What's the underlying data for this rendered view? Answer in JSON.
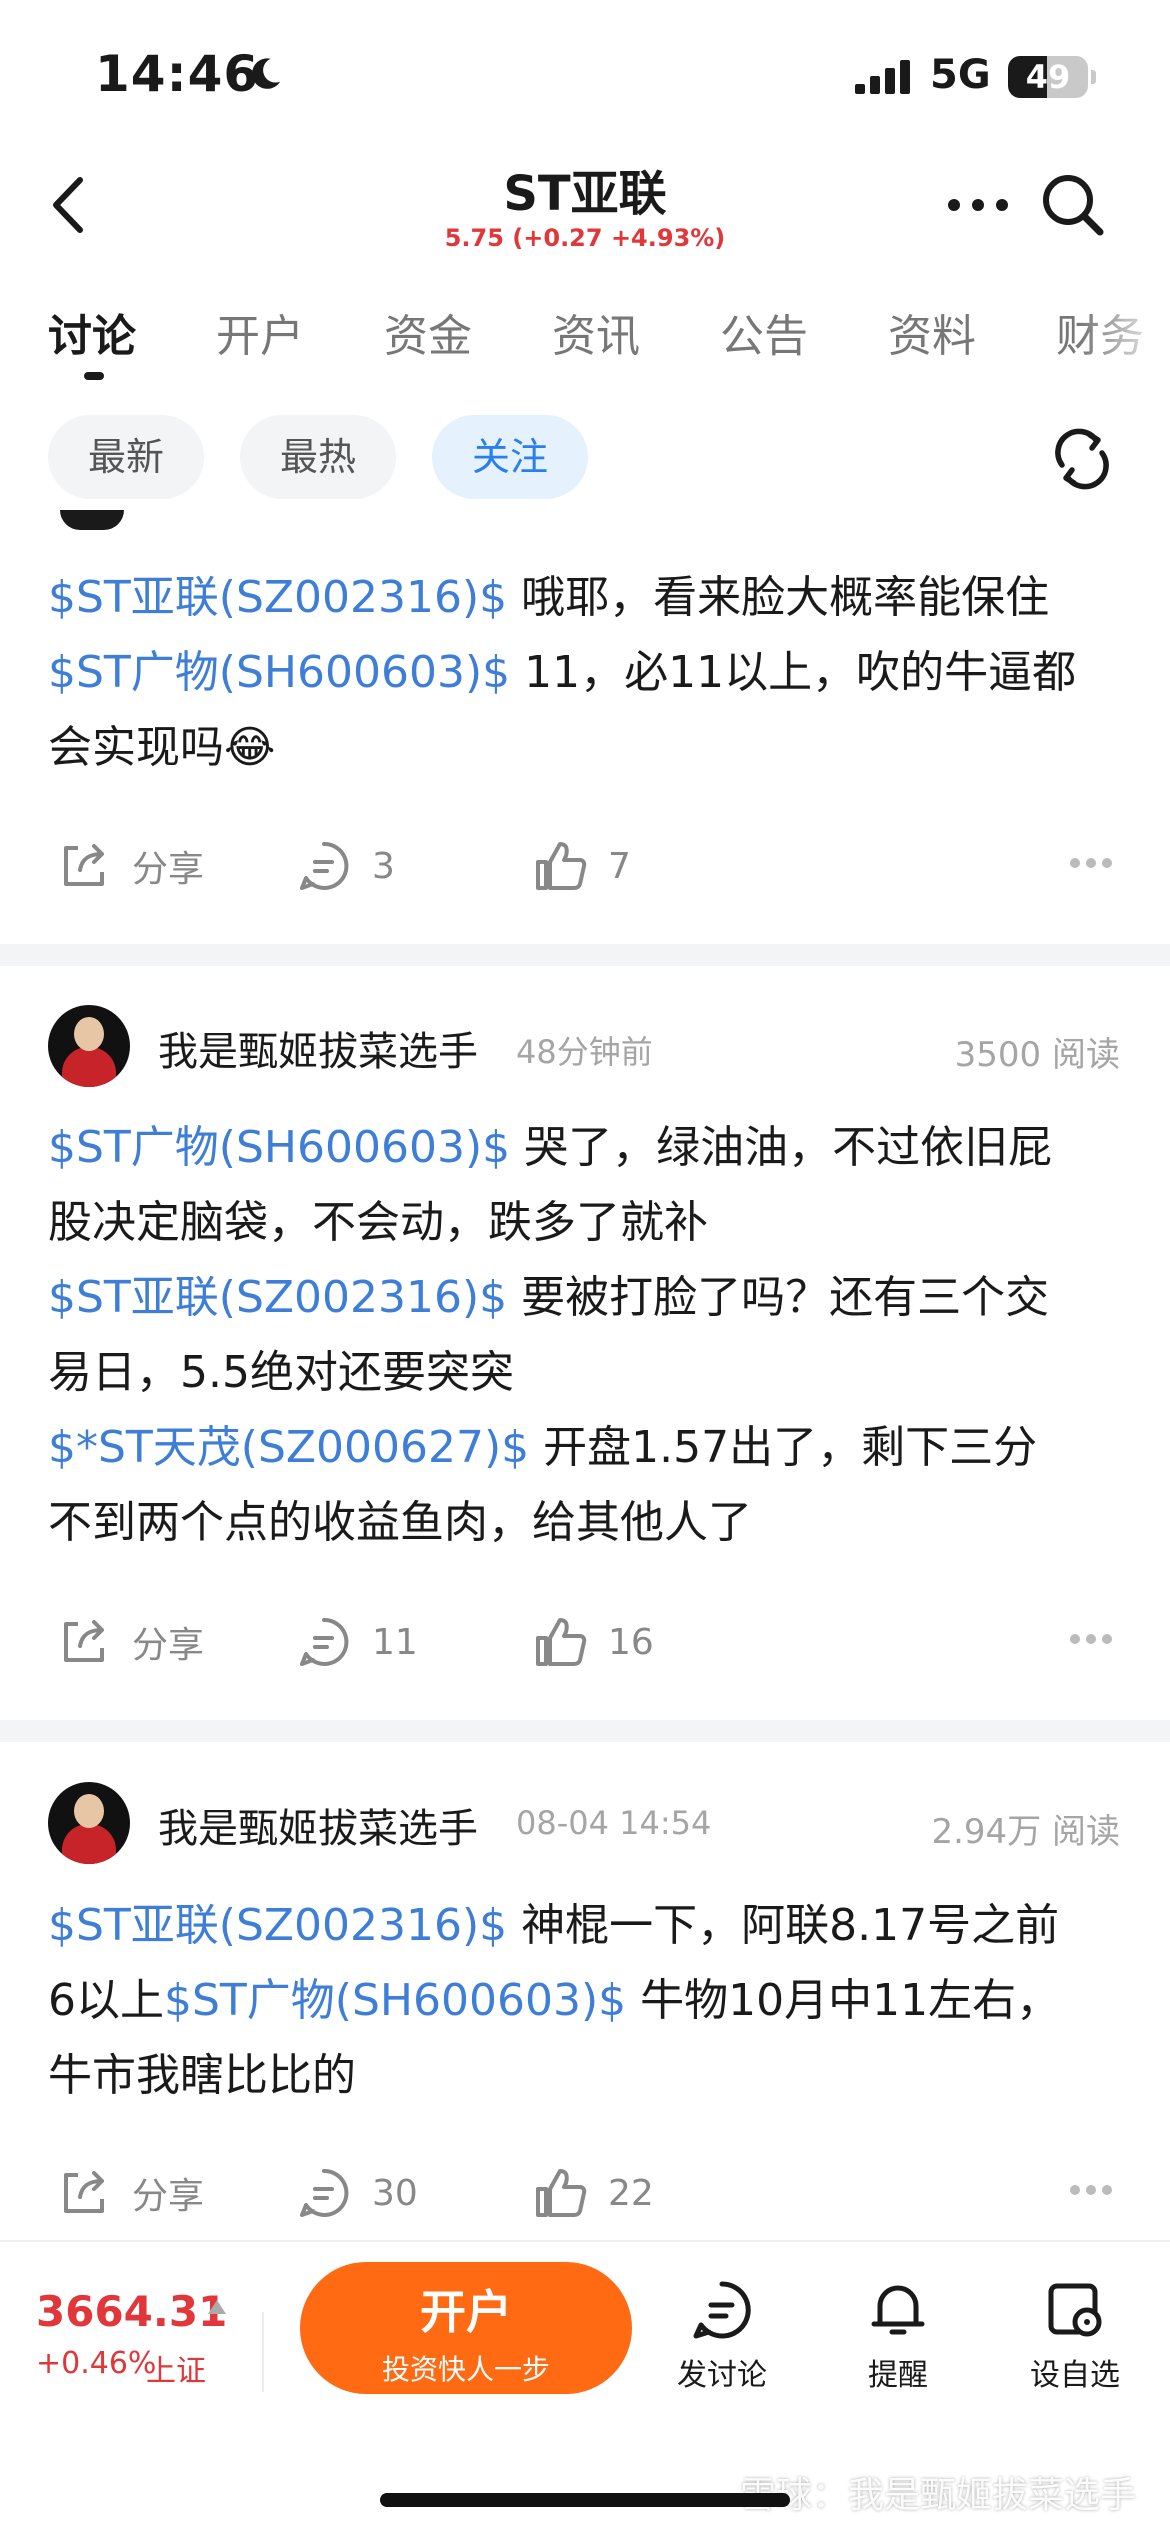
{
  "status_bar": {
    "time": "14:46",
    "network": "5G",
    "battery": "49",
    "battery_level": 0.49
  },
  "header": {
    "title": "ST亚联",
    "price_line": "5.75 (+0.27 +4.93%)",
    "price_color": "#e1373b"
  },
  "tabs": [
    {
      "label": "讨论",
      "active": true
    },
    {
      "label": "开户"
    },
    {
      "label": "资金"
    },
    {
      "label": "资讯"
    },
    {
      "label": "公告"
    },
    {
      "label": "资料"
    },
    {
      "label": "财务"
    }
  ],
  "filters": [
    {
      "label": "最新"
    },
    {
      "label": "最热"
    },
    {
      "label": "关注",
      "active": true
    }
  ],
  "posts": [
    {
      "content": {
        "l1_tag": "$ST亚联(SZ002316)$",
        "l1_text": " 哦耶，看来脸大概率能保住",
        "l2_tag": "$ST广物(SH600603)$",
        "l2_text": " 11，必11以上，吹的牛逼都",
        "l3_text": "会实现吗😂"
      },
      "actions": {
        "share": "分享",
        "comments": "3",
        "likes": "7"
      }
    },
    {
      "author": "我是甄姬拔菜选手",
      "time": "48分钟前",
      "reads": "3500 阅读",
      "content": {
        "l1_tag": "$ST广物(SH600603)$",
        "l1_text": " 哭了，绿油油，不过依旧屁",
        "l2_text": "股决定脑袋，不会动，跌多了就补",
        "l3_tag": "$ST亚联(SZ002316)$",
        "l3_text": " 要被打脸了吗？还有三个交",
        "l4_text": "易日，5.5绝对还要突突",
        "l5_tag": "$*ST天茂(SZ000627)$",
        "l5_text": " 开盘1.57出了，剩下三分",
        "l6_text": "不到两个点的收益鱼肉，给其他人了"
      },
      "actions": {
        "share": "分享",
        "comments": "11",
        "likes": "16"
      }
    },
    {
      "author": "我是甄姬拔菜选手",
      "time": "08-04 14:54",
      "reads": "2.94万 阅读",
      "content": {
        "l1_tag": "$ST亚联(SZ002316)$",
        "l1_text": " 神棍一下，阿联8.17号之前",
        "l2_pre": "6以上",
        "l2_tag": "$ST广物(SH600603)$",
        "l2_text": " 牛物10月中11左右，",
        "l3_text": "牛市我瞎比比的"
      },
      "actions": {
        "share": "分享",
        "comments": "30",
        "likes": "22"
      }
    }
  ],
  "bottom_bar": {
    "index_value": "3664.31",
    "index_change": "+0.46%",
    "index_name": "上证",
    "open_main": "开户",
    "open_sub": "投资快人一步",
    "nav": [
      {
        "label": "发讨论"
      },
      {
        "label": "提醒"
      },
      {
        "label": "设自选"
      }
    ],
    "accent": "#ff6a13"
  },
  "watermark": "雪球：我是甄姬拔菜选手",
  "colors": {
    "tag": "#3e7ed7",
    "up": "#e1373b",
    "active_pill_bg": "#e6f1fe",
    "active_pill_text": "#2a7ef0"
  }
}
